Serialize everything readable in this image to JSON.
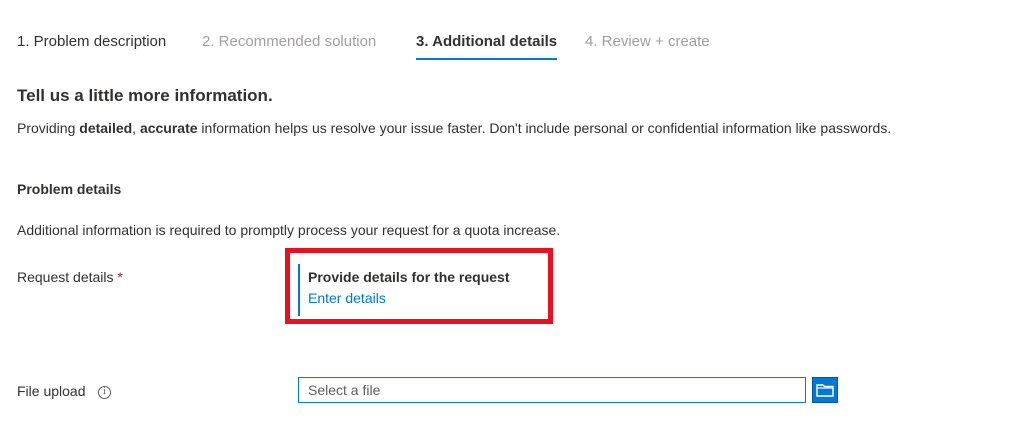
{
  "tabs": [
    {
      "label": "1. Problem description",
      "state": "done"
    },
    {
      "label": "2. Recommended solution",
      "state": "disabled"
    },
    {
      "label": "3. Additional details",
      "state": "active"
    },
    {
      "label": "4. Review + create",
      "state": "disabled"
    }
  ],
  "heading": "Tell us a little more information.",
  "intro": {
    "part1": "Providing ",
    "bold1": "detailed",
    "part2": ", ",
    "bold2": "accurate",
    "part3": " information helps us resolve your issue faster. Don't include personal or confidential information like passwords."
  },
  "problem_details": {
    "title": "Problem details",
    "description": "Additional information is required to promptly process your request for a quota increase.",
    "request_label": "Request details",
    "required_marker": "*",
    "panel_title": "Provide details for the request",
    "panel_link": "Enter details"
  },
  "file_upload": {
    "label": "File upload",
    "info_glyph": "i",
    "placeholder": "Select a file"
  },
  "colors": {
    "accent": "#0078d4",
    "highlight": "#e81123",
    "required": "#a4262c"
  }
}
